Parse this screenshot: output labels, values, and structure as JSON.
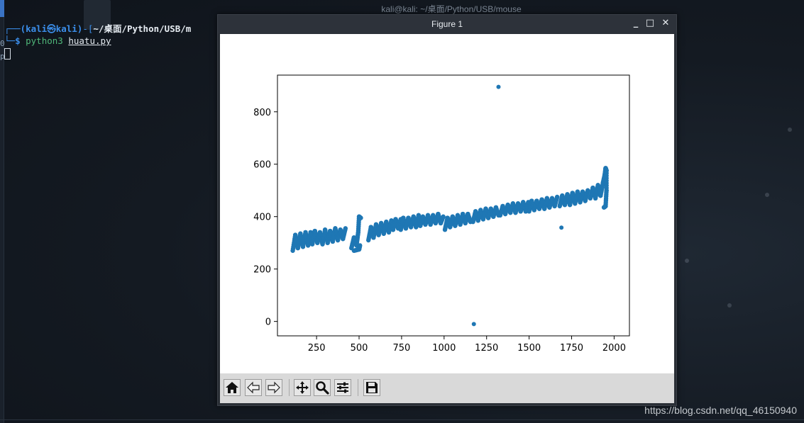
{
  "terminal": {
    "window_title": "kali@kali: ~/桌面/Python/USB/mouse",
    "prompt_user": "(kali㉿kali)",
    "prompt_dash": "-[",
    "prompt_path": "~/桌面/Python/USB/m",
    "prompt_dollar": "$",
    "command": "python3",
    "command_arg": "huatu.py"
  },
  "figure_window": {
    "title": "Figure 1",
    "minimize_label": "_",
    "maximize_label": "□",
    "close_label": "✕"
  },
  "toolbar": {
    "buttons": [
      "home-icon",
      "back-icon",
      "forward-icon",
      "pan-icon",
      "zoom-icon",
      "configure-subplots-icon",
      "save-icon"
    ]
  },
  "chart_data": {
    "type": "scatter",
    "title": "",
    "xlabel": "",
    "ylabel": "",
    "xlim": [
      20,
      2090
    ],
    "ylim": [
      -55,
      940
    ],
    "xticks": [
      250,
      500,
      750,
      1000,
      1250,
      1500,
      1750,
      2000
    ],
    "yticks": [
      0,
      200,
      400,
      600,
      800
    ],
    "color": "#1f77b4",
    "outliers": [
      [
        1320,
        895
      ],
      [
        1175,
        -10
      ],
      [
        1690,
        358
      ]
    ],
    "stroke_paths": [
      [
        [
          110,
          270
        ],
        [
          125,
          330
        ],
        [
          140,
          280
        ],
        [
          155,
          335
        ],
        [
          170,
          285
        ],
        [
          185,
          340
        ],
        [
          200,
          290
        ],
        [
          215,
          340
        ],
        [
          225,
          295
        ],
        [
          240,
          345
        ],
        [
          255,
          300
        ],
        [
          270,
          340
        ],
        [
          285,
          295
        ],
        [
          300,
          350
        ],
        [
          315,
          300
        ],
        [
          330,
          345
        ],
        [
          345,
          305
        ],
        [
          360,
          355
        ],
        [
          375,
          310
        ],
        [
          390,
          350
        ],
        [
          405,
          315
        ],
        [
          420,
          355
        ]
      ],
      [
        [
          455,
          280
        ],
        [
          470,
          320
        ],
        [
          485,
          290
        ],
        [
          495,
          340
        ],
        [
          500,
          400
        ],
        [
          510,
          395
        ]
      ],
      [
        [
          470,
          270
        ],
        [
          500,
          275
        ],
        [
          505,
          290
        ]
      ],
      [
        [
          555,
          310
        ],
        [
          570,
          360
        ],
        [
          585,
          320
        ],
        [
          600,
          370
        ],
        [
          615,
          330
        ],
        [
          630,
          375
        ],
        [
          645,
          335
        ],
        [
          660,
          380
        ],
        [
          675,
          340
        ],
        [
          690,
          385
        ],
        [
          700,
          350
        ],
        [
          715,
          390
        ],
        [
          730,
          355
        ],
        [
          745,
          390
        ]
      ],
      [
        [
          745,
          350
        ],
        [
          760,
          395
        ],
        [
          775,
          355
        ],
        [
          790,
          395
        ],
        [
          805,
          360
        ],
        [
          820,
          400
        ],
        [
          835,
          360
        ],
        [
          850,
          405
        ],
        [
          860,
          365
        ]
      ],
      [
        [
          860,
          365
        ],
        [
          875,
          400
        ],
        [
          890,
          370
        ],
        [
          905,
          405
        ],
        [
          920,
          370
        ],
        [
          935,
          405
        ],
        [
          950,
          375
        ],
        [
          965,
          410
        ],
        [
          980,
          375
        ],
        [
          995,
          400
        ]
      ],
      [
        [
          1005,
          350
        ],
        [
          1020,
          395
        ],
        [
          1035,
          360
        ],
        [
          1050,
          400
        ],
        [
          1065,
          365
        ],
        [
          1080,
          405
        ],
        [
          1095,
          370
        ],
        [
          1110,
          410
        ],
        [
          1125,
          375
        ],
        [
          1140,
          410
        ],
        [
          1155,
          380
        ]
      ],
      [
        [
          1170,
          380
        ],
        [
          1185,
          420
        ],
        [
          1200,
          385
        ],
        [
          1215,
          425
        ],
        [
          1230,
          390
        ],
        [
          1245,
          430
        ],
        [
          1260,
          395
        ],
        [
          1275,
          430
        ],
        [
          1290,
          400
        ],
        [
          1305,
          435
        ],
        [
          1320,
          405
        ]
      ],
      [
        [
          1330,
          405
        ],
        [
          1345,
          440
        ],
        [
          1360,
          410
        ],
        [
          1375,
          445
        ],
        [
          1390,
          415
        ],
        [
          1405,
          450
        ],
        [
          1420,
          415
        ],
        [
          1435,
          450
        ],
        [
          1450,
          420
        ],
        [
          1465,
          455
        ],
        [
          1480,
          420
        ],
        [
          1495,
          455
        ]
      ],
      [
        [
          1500,
          420
        ],
        [
          1515,
          460
        ],
        [
          1530,
          425
        ],
        [
          1545,
          460
        ],
        [
          1560,
          430
        ],
        [
          1575,
          465
        ],
        [
          1590,
          430
        ],
        [
          1605,
          470
        ],
        [
          1620,
          435
        ],
        [
          1635,
          470
        ],
        [
          1650,
          440
        ],
        [
          1665,
          475
        ]
      ],
      [
        [
          1680,
          440
        ],
        [
          1695,
          480
        ],
        [
          1710,
          445
        ],
        [
          1725,
          485
        ],
        [
          1740,
          445
        ],
        [
          1755,
          490
        ],
        [
          1770,
          450
        ],
        [
          1785,
          495
        ],
        [
          1800,
          455
        ],
        [
          1815,
          495
        ],
        [
          1830,
          460
        ],
        [
          1845,
          500
        ]
      ],
      [
        [
          1860,
          470
        ],
        [
          1875,
          510
        ],
        [
          1890,
          470
        ],
        [
          1905,
          520
        ],
        [
          1920,
          480
        ],
        [
          1935,
          530
        ],
        [
          1945,
          560
        ],
        [
          1950,
          585
        ],
        [
          1955,
          575
        ],
        [
          1955,
          500
        ],
        [
          1950,
          440
        ],
        [
          1940,
          435
        ]
      ]
    ]
  }
}
